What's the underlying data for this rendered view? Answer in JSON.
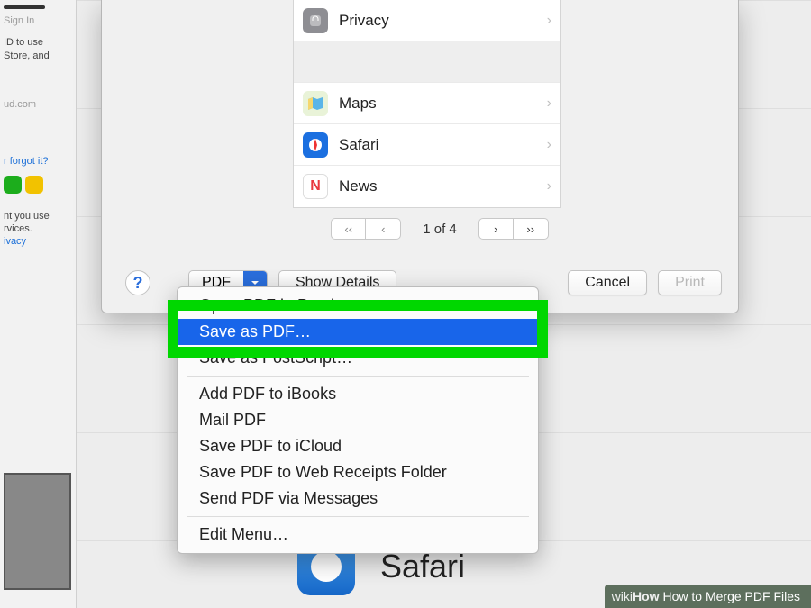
{
  "bg_left": {
    "sign_in": "Sign In",
    "line1": "ID to use",
    "line2": "Store, and",
    "line3": "ud.com",
    "forgot": "r forgot it?",
    "footer1": "nt you use",
    "footer2": "rvices.",
    "privacy_link": "ivacy"
  },
  "settings": [
    {
      "key": "privacy",
      "label": "Privacy",
      "icon_bg": "#8e8e93",
      "glyph": "✋"
    },
    {
      "key": "blank",
      "label": "",
      "icon_bg": "transparent",
      "glyph": ""
    },
    {
      "key": "maps",
      "label": "Maps",
      "icon_bg": "#f4f4ef",
      "glyph": "🗺"
    },
    {
      "key": "safari",
      "label": "Safari",
      "icon_bg": "#1b6fe0",
      "glyph": "🧭"
    },
    {
      "key": "news",
      "label": "News",
      "icon_bg": "#ffffff",
      "glyph": "N"
    }
  ],
  "pager": {
    "label": "1 of 4"
  },
  "buttons": {
    "help": "?",
    "pdf": "PDF",
    "show_details": "Show Details",
    "cancel": "Cancel",
    "print": "Print"
  },
  "menu": {
    "group1": [
      "Open PDF in Preview",
      "Save as PDF…",
      "Save as PostScript…"
    ],
    "group2": [
      "Add PDF to iBooks",
      "Mail PDF",
      "Save PDF to iCloud",
      "Save PDF to Web Receipts Folder",
      "Send PDF via Messages"
    ],
    "group3": [
      "Edit Menu…"
    ],
    "selected_index": 1
  },
  "under": {
    "label": "Safari"
  },
  "caption": {
    "brand_pre": "wiki",
    "brand_bold": "How",
    "title": "How to Merge PDF Files"
  }
}
